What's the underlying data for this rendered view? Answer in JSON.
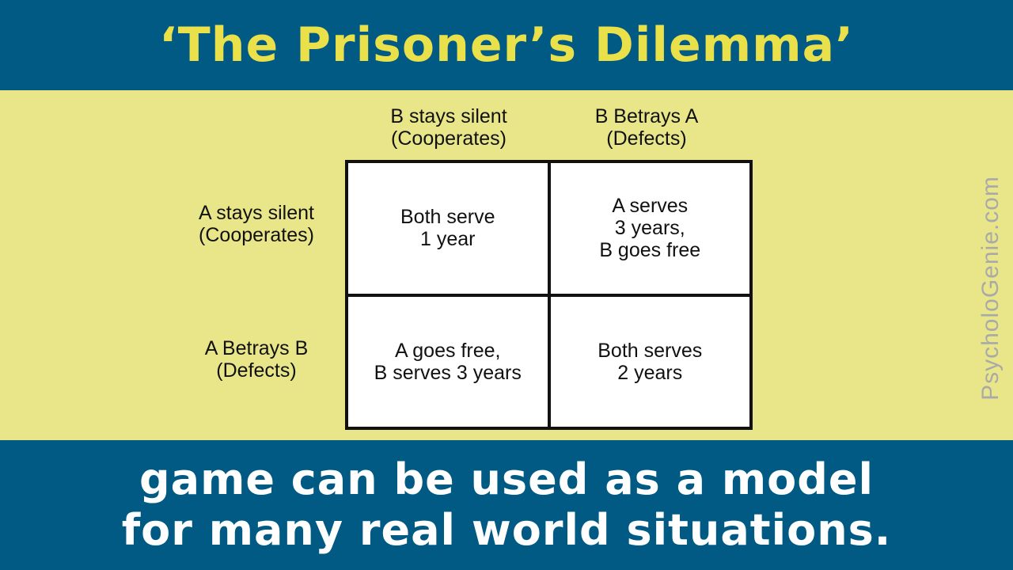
{
  "colors": {
    "band": "#005a83",
    "title_text": "#e9e04a",
    "caption_text": "#ffffff",
    "background": "#e9e68a"
  },
  "title": "‘The Prisoner’s Dilemma’",
  "columns": [
    {
      "lines": [
        "B stays silent",
        "(Cooperates)"
      ]
    },
    {
      "lines": [
        "B Betrays A",
        "(Defects)"
      ]
    }
  ],
  "rows": [
    {
      "lines": [
        "A stays silent",
        "(Cooperates)"
      ]
    },
    {
      "lines": [
        "A Betrays B",
        "(Defects)"
      ]
    }
  ],
  "cells": [
    [
      {
        "lines": [
          "Both serve",
          "1 year"
        ]
      },
      {
        "lines": [
          "A serves",
          "3 years,",
          "B goes free"
        ]
      }
    ],
    [
      {
        "lines": [
          "A goes free,",
          "B serves 3 years"
        ]
      },
      {
        "lines": [
          "Both serves",
          "2 years"
        ]
      }
    ]
  ],
  "caption": {
    "line1": "game can be used as a model",
    "line2": "for many real world situations."
  },
  "watermark": "PsycholoGenie.com"
}
